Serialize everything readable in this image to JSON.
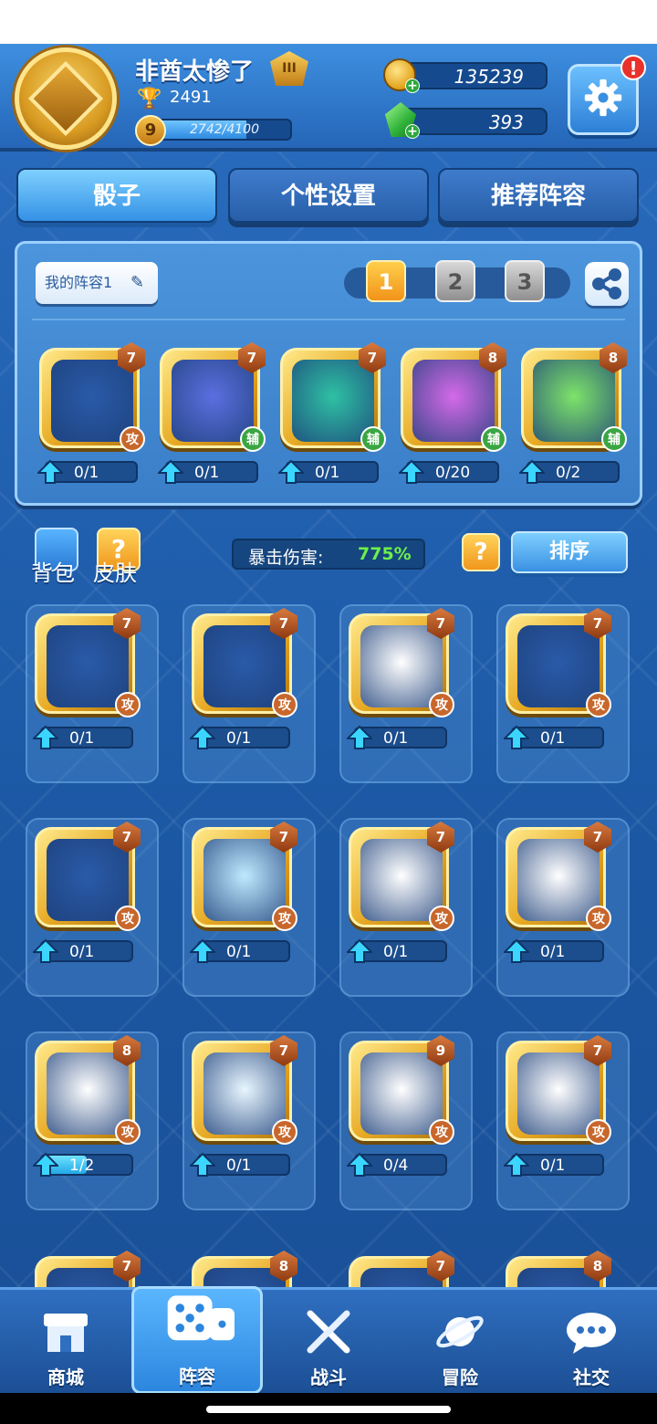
{
  "player": {
    "name": "非酋太惨了",
    "rank_badge": "III",
    "trophies": "2491",
    "level": "9",
    "xp_text": "2742/4100",
    "xp_fraction": 0.669
  },
  "currency": {
    "gold": "135239",
    "gems": "393"
  },
  "settings": {
    "alert_badge": "!"
  },
  "tabs": [
    {
      "label": "骰子"
    },
    {
      "label": "个性设置"
    },
    {
      "label": "推荐阵容"
    }
  ],
  "deck": {
    "name": "我的阵容1",
    "deck_numbers": [
      "1",
      "2",
      "3"
    ],
    "selected_deck": "1",
    "cards": [
      {
        "level": "7",
        "tag": "攻",
        "tag_type": "atk",
        "progress": "0/1",
        "fill": 0,
        "icon": "bow-icon",
        "color": "#2a5aa8"
      },
      {
        "level": "7",
        "tag": "辅",
        "tag_type": "sup",
        "progress": "0/1",
        "fill": 0,
        "icon": "mask-icon",
        "color": "#5b6fe0"
      },
      {
        "level": "7",
        "tag": "辅",
        "tag_type": "sup",
        "progress": "0/1",
        "fill": 0,
        "icon": "swirl-icon",
        "color": "#2fc1a4"
      },
      {
        "level": "8",
        "tag": "辅",
        "tag_type": "sup",
        "progress": "0/20",
        "fill": 0,
        "icon": "magic-hat-icon",
        "color": "#d46ae8"
      },
      {
        "level": "8",
        "tag": "辅",
        "tag_type": "sup",
        "progress": "0/2",
        "fill": 0,
        "icon": "plus-icon",
        "color": "#7ee36a"
      }
    ]
  },
  "toolbar": {
    "bag_label": "背包",
    "skin_label": "皮肤",
    "crit_label": "暴击伤害:",
    "crit_value": "775%",
    "help_label": "?",
    "sort_label": "排序"
  },
  "collection": [
    {
      "level": "7",
      "tag": "攻",
      "progress": "0/1",
      "fill": 0,
      "icon": "pisces-icon",
      "color": "#2a5aa8"
    },
    {
      "level": "7",
      "tag": "攻",
      "progress": "0/1",
      "fill": 0,
      "icon": "aquarius-icon",
      "color": "#2a5aa8"
    },
    {
      "level": "7",
      "tag": "攻",
      "progress": "0/1",
      "fill": 0,
      "icon": "demon-icon",
      "color": "#ffffff"
    },
    {
      "level": "7",
      "tag": "攻",
      "progress": "0/1",
      "fill": 0,
      "icon": "sagittarius-icon",
      "color": "#2a5aa8"
    },
    {
      "level": "7",
      "tag": "攻",
      "progress": "0/1",
      "fill": 0,
      "icon": "scorpio-icon",
      "color": "#2a5aa8"
    },
    {
      "level": "7",
      "tag": "攻",
      "progress": "0/1",
      "fill": 0,
      "icon": "lightning-icon",
      "color": "#bfe9ff"
    },
    {
      "level": "7",
      "tag": "攻",
      "progress": "0/1",
      "fill": 0,
      "icon": "ghost-icon",
      "color": "#ffffff"
    },
    {
      "level": "7",
      "tag": "攻",
      "progress": "0/1",
      "fill": 0,
      "icon": "flower-icon",
      "color": "#ffffff"
    },
    {
      "level": "8",
      "tag": "攻",
      "progress": "1/2",
      "fill": 0.5,
      "icon": "fire-icon",
      "color": "#ffffff"
    },
    {
      "level": "7",
      "tag": "攻",
      "progress": "0/1",
      "fill": 0,
      "icon": "water-icon",
      "color": "#e8f6ff"
    },
    {
      "level": "9",
      "tag": "攻",
      "progress": "0/4",
      "fill": 0,
      "icon": "shield-icon",
      "color": "#ffffff"
    },
    {
      "level": "7",
      "tag": "攻",
      "progress": "0/1",
      "fill": 0,
      "icon": "pumpkin-icon",
      "color": "#ffffff"
    },
    {
      "level": "7",
      "icon": "partial-die-icon"
    },
    {
      "level": "8",
      "icon": "partial-die-icon"
    },
    {
      "level": "7",
      "icon": "partial-die-icon"
    },
    {
      "level": "8",
      "icon": "partial-die-icon"
    }
  ],
  "nav": [
    {
      "label": "商城",
      "icon": "shop-icon"
    },
    {
      "label": "阵容",
      "icon": "dice-icon"
    },
    {
      "label": "战斗",
      "icon": "swords-icon"
    },
    {
      "label": "冒险",
      "icon": "planet-icon"
    },
    {
      "label": "社交",
      "icon": "chat-icon"
    }
  ]
}
